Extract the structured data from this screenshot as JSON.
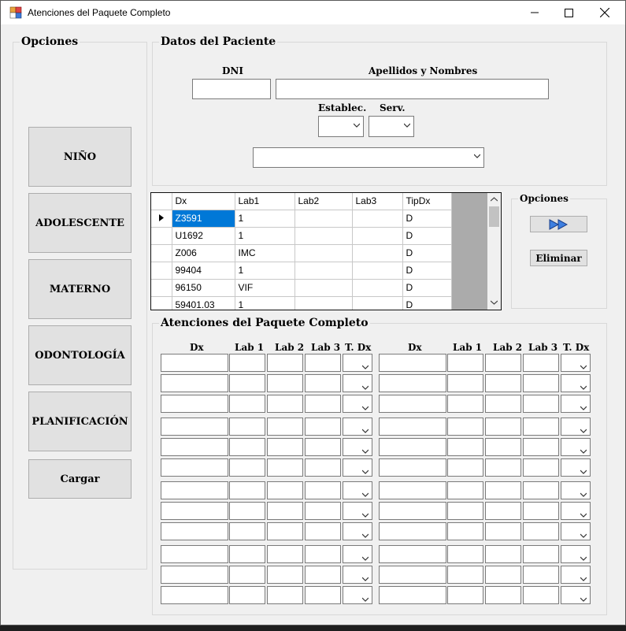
{
  "window": {
    "title": "Atenciones del Paquete Completo"
  },
  "sidebar": {
    "legend": "Opciones",
    "buttons": [
      "NIÑO",
      "ADOLESCENTE",
      "MATERNO",
      "ODONTOLOGÍA",
      "PLANIFICACIÓN"
    ],
    "load_button": "Cargar"
  },
  "patient": {
    "legend": "Datos del Paciente",
    "dni_label": "DNI",
    "dni_value": "",
    "name_label": "Apellidos y Nombres",
    "name_value": "",
    "establec_label": "Establec.",
    "serv_label": "Serv."
  },
  "grid": {
    "columns": [
      "Dx",
      "Lab1",
      "Lab2",
      "Lab3",
      "TipDx"
    ],
    "rows": [
      [
        "Z3591",
        "1",
        "",
        "",
        "D"
      ],
      [
        "U1692",
        "1",
        "",
        "",
        "D"
      ],
      [
        "Z006",
        "IMC",
        "",
        "",
        "D"
      ],
      [
        "99404",
        "1",
        "",
        "",
        "D"
      ],
      [
        "96150",
        "VIF",
        "",
        "",
        "D"
      ],
      [
        "59401.03",
        "1",
        "",
        "",
        "D"
      ]
    ],
    "current_row": 0
  },
  "options": {
    "legend": "Opciones",
    "delete_button": "Eliminar"
  },
  "atenciones": {
    "legend": "Atenciones del Paquete Completo",
    "headers": [
      "Dx",
      "Lab 1",
      "Lab 2",
      "Lab 3",
      "T. Dx"
    ],
    "row_count": 12
  }
}
